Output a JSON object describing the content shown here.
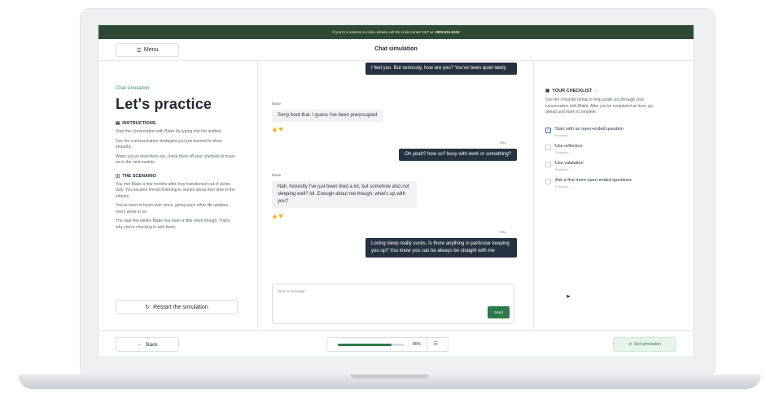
{
  "banner": {
    "text": "If you're a veteran in crisis, please call the crisis center 24/7 at",
    "phone": "1800-631-2432"
  },
  "header": {
    "menu_label": "Menu",
    "title": "Chat simulation"
  },
  "left": {
    "eyebrow": "Chat simulation",
    "heading": "Let's practice",
    "instructions_title": "INSTRUCTIONS",
    "instructions": [
      "Start the conversation with Blake by typing into the textbox.",
      "Use the communication strategies you just learned to show empathy.",
      "When you've tried them out, check them off your checklist to move on to the next module."
    ],
    "scenario_title": "THE SCENARIO",
    "scenario": [
      "You met Blake a few months after they transitioned out of active duty. You became friends listening to stories about their time in the infantry.",
      "You've been in touch ever since, giving each other life updates every week or so.",
      "The past few weeks Blake has been a little silent though. That's why you're checking in with them."
    ],
    "restart_label": "Restart the simulation"
  },
  "chat": {
    "messages": [
      {
        "from": "You",
        "text": "I feel you. But seriously, how are you? You've been quiet lately"
      },
      {
        "from": "Blake",
        "text": "Sorry bout that. I guess I've been preoccupied"
      },
      {
        "from": "You",
        "text": "Oh yeah? how so? busy with work or something?"
      },
      {
        "from": "Blake",
        "text": "Nah. honestly I've just been tired a lot, but somehow also not sleeping well? lol. Enough about me though, what's up with you?"
      },
      {
        "from": "You",
        "text": "Losing sleep really sucks. Is there anything in particular keeping you up? You know you can be always be straight with me"
      }
    ],
    "input_placeholder": "Send a message",
    "send_label": "Send"
  },
  "checklist": {
    "title": "YOUR CHECKLIST",
    "description": "Use the checklist below to help guide you through your conversation with Blake. After you've completed an item, go ahead and mark it complete.",
    "items": [
      {
        "label": "Start with an open-ended question",
        "sub": "Example ⌄",
        "checked": true
      },
      {
        "label": "Use reflection",
        "sub": "Example ⌄",
        "checked": false
      },
      {
        "label": "Use validation",
        "sub": "Example ⌄",
        "checked": false
      },
      {
        "label": "Ask a few more open-ended questions",
        "sub": "Example ⌄",
        "checked": false
      }
    ]
  },
  "footer": {
    "back_label": "Back",
    "progress_percent": 80,
    "progress_text": "80%",
    "end_label": "End simulation"
  },
  "colors": {
    "banner": "#2c4a34",
    "accent": "#2f7a4b",
    "user_bubble": "#243242",
    "eyebrow": "#2f9a53"
  }
}
